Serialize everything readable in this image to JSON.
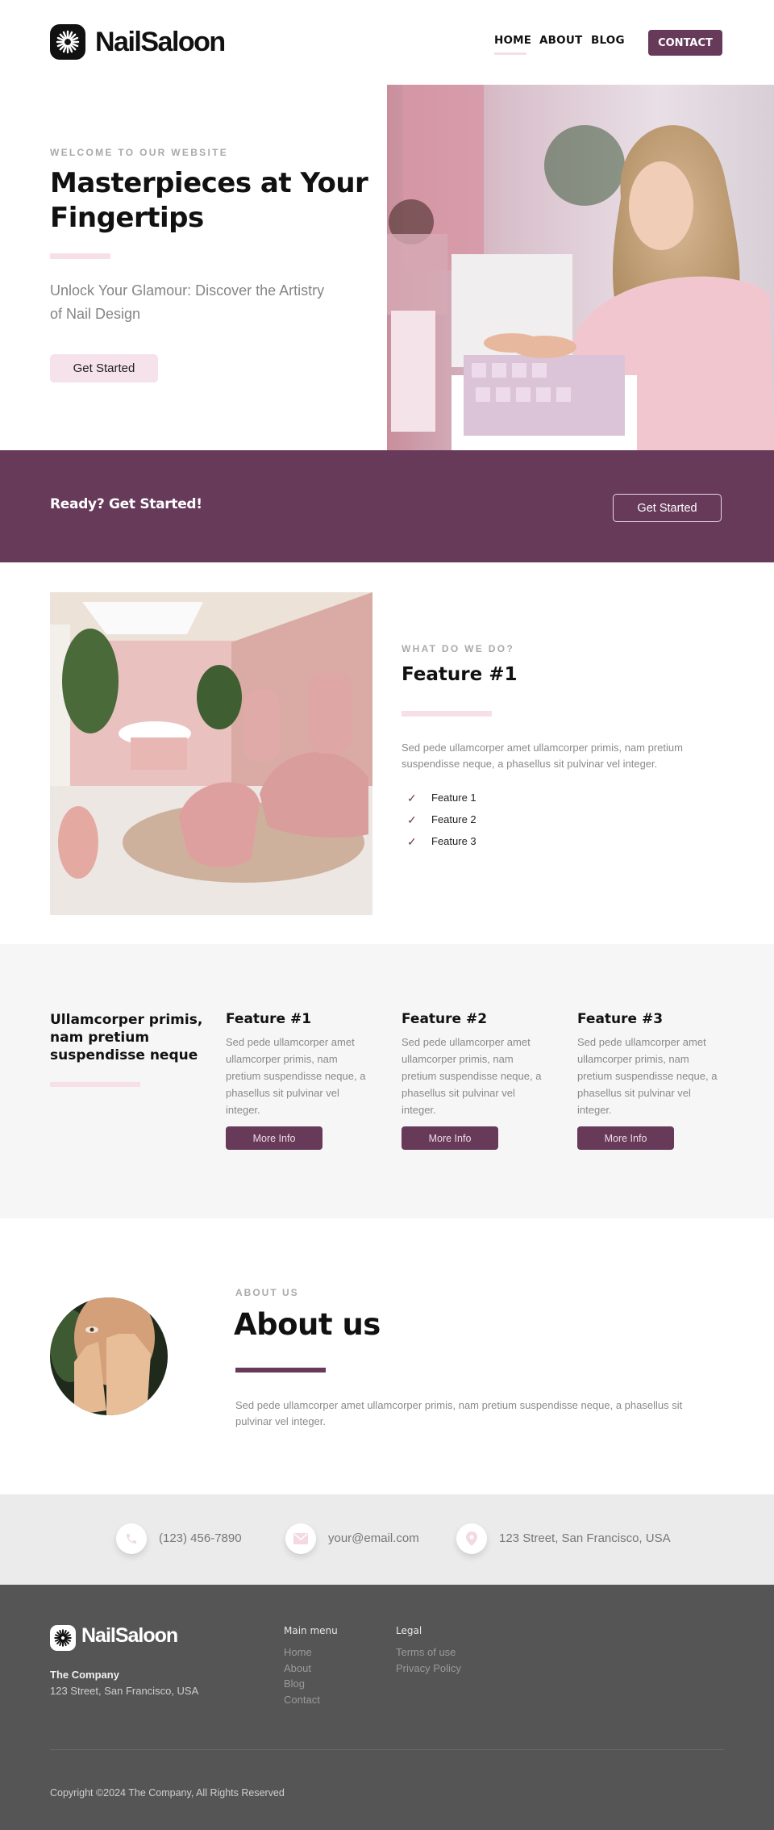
{
  "brand": {
    "name": "NailSaloon",
    "logo_icon": "sunburst-icon"
  },
  "nav": {
    "items": [
      {
        "label": "HOME",
        "active": true
      },
      {
        "label": "ABOUT",
        "active": false
      },
      {
        "label": "BLOG",
        "active": false
      }
    ],
    "contact_label": "CONTACT"
  },
  "hero": {
    "eyebrow": "WELCOME TO OUR WEBSITE",
    "title_line1": "Masterpieces at Your",
    "title_line2": "Fingertips",
    "subtitle": "Unlock Your Glamour: Discover the Artistry of Nail Design",
    "cta_label": "Get Started",
    "image_alt": "Woman in pink sweater arranging nail polish"
  },
  "cta_band": {
    "text": "Ready? Get Started!",
    "button_label": "Get Started"
  },
  "feature": {
    "image_alt": "Pink salon interior with pedicure chairs",
    "eyebrow": "WHAT DO WE DO?",
    "title": "Feature #1",
    "body": "Sed pede ullamcorper amet ullamcorper primis, nam pretium suspendisse neque, a phasellus sit pulvinar vel integer.",
    "list": [
      "Feature 1",
      "Feature 2",
      "Feature 3"
    ]
  },
  "features_grid": {
    "intro": "Ullamcorper primis, nam pretium suspendisse neque",
    "items": [
      {
        "title": "Feature #1",
        "body": "Sed pede ullamcorper amet ullamcorper primis, nam pretium suspendisse neque, a phasellus sit pulvinar vel integer.",
        "button": "More Info"
      },
      {
        "title": "Feature #2",
        "body": "Sed pede ullamcorper amet ullamcorper primis, nam pretium suspendisse neque, a phasellus sit pulvinar vel integer.",
        "button": "More Info"
      },
      {
        "title": "Feature #3",
        "body": "Sed pede ullamcorper amet ullamcorper primis, nam pretium suspendisse neque, a phasellus sit pulvinar vel integer.",
        "button": "More Info"
      }
    ]
  },
  "about": {
    "eyebrow": "ABOUT US",
    "title": "About us",
    "body": "Sed pede ullamcorper amet ullamcorper primis, nam pretium suspendisse neque, a phasellus sit pulvinar vel integer.",
    "image_alt": "Woman covering face with manicured hands"
  },
  "contact": {
    "phone": "(123) 456-7890",
    "email": "your@email.com",
    "address": "123 Street, San Francisco, USA"
  },
  "footer": {
    "company": "The Company",
    "address": "123 Street, San Francisco, USA",
    "main_menu": {
      "heading": "Main menu",
      "links": [
        "Home",
        "About",
        "Blog",
        "Contact"
      ]
    },
    "legal": {
      "heading": "Legal",
      "links": [
        "Terms of use",
        "Privacy Policy"
      ]
    },
    "copyright": "Copyright ©2024 The Company, All Rights Reserved"
  },
  "colors": {
    "accent": "#673a5a",
    "pink": "#f6dfe7",
    "footer_bg": "#555555",
    "contact_bg": "#ebebeb",
    "gray_section": "#f6f6f6"
  }
}
